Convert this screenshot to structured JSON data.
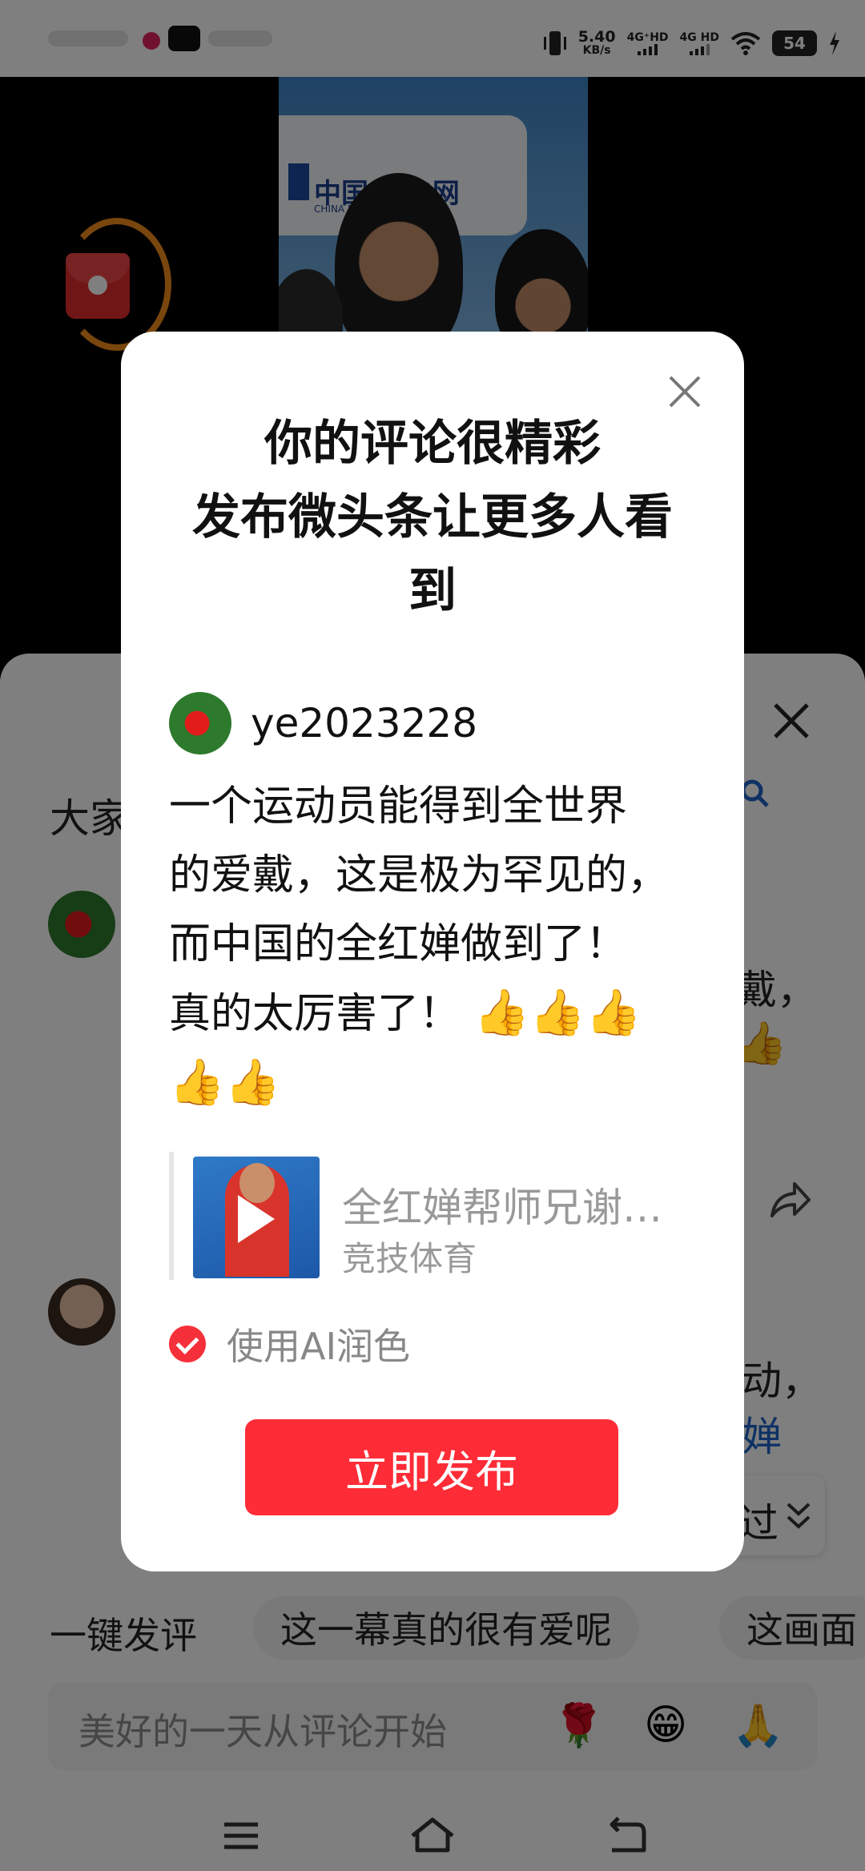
{
  "status_bar": {
    "net_speed": "5.40",
    "net_speed_unit": "KB/s",
    "sim1": "4G⁺HD",
    "sim2": "4G HD",
    "battery": "54"
  },
  "video": {
    "banner_text": "中国",
    "banner_text2": "电网",
    "banner_sub": "CHINA        R GRID"
  },
  "comments_sheet": {
    "title_partial": "大家",
    "comment1_tail": "戴，",
    "comment2_tail": "动，",
    "comment2_link_tail": "婵",
    "collapse_label": "过"
  },
  "quick_comments": {
    "lead": "一键发评",
    "chips": [
      "这一幕真的很有爱呢",
      "这画面"
    ]
  },
  "input": {
    "placeholder": "美好的一天从评论开始",
    "emojis": [
      "🌹",
      "😁",
      "🙏"
    ]
  },
  "dialog": {
    "title_lines": [
      "你的评论很精彩",
      "发布微头条让更多人看",
      "到"
    ],
    "username": "ye2023228",
    "comment_lines": [
      "一个运动员能得到全世界",
      "的爱戴，这是极为罕见的，",
      "而中国的全红婵做到了！",
      "真的太厉害了！"
    ],
    "thumbs": [
      "👍",
      "👍",
      "👍",
      "👍",
      "👍"
    ],
    "reference": {
      "title": "全红婵帮师兄谢…",
      "channel": "竞技体育"
    },
    "ai_polish_label": "使用AI润色",
    "ai_polish_checked": true,
    "publish_label": "立即发布"
  },
  "colors": {
    "accent": "#fe2c37",
    "link": "#1e63c8"
  }
}
